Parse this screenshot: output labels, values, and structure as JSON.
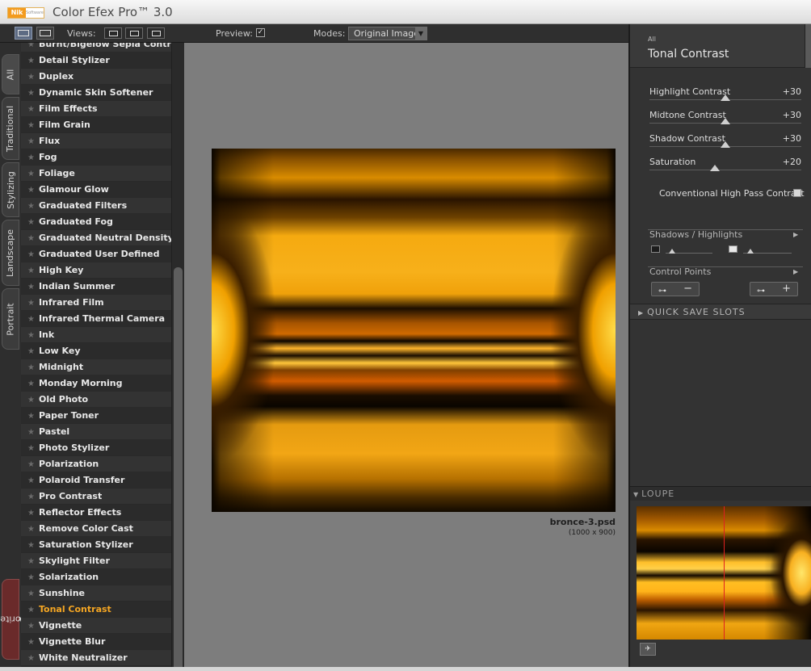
{
  "app": {
    "title": "Color Efex Pro™ 3.0",
    "logo_brand": "Nik",
    "logo_sub": "Software"
  },
  "toolbar": {
    "views_label": "Views:",
    "preview_label": "Preview:",
    "preview_checked": true,
    "modes_label": "Modes:",
    "modes_value": "Original Image"
  },
  "tabs": [
    {
      "label": "All",
      "active": true
    },
    {
      "label": "Traditional"
    },
    {
      "label": "Stylizing"
    },
    {
      "label": "Landscape"
    },
    {
      "label": "Portrait"
    },
    {
      "label": "Favorites"
    }
  ],
  "filters": [
    {
      "name": "Burnt/Bigelow Sepia Contrast"
    },
    {
      "name": "Detail Stylizer"
    },
    {
      "name": "Duplex"
    },
    {
      "name": "Dynamic Skin Softener"
    },
    {
      "name": "Film Effects"
    },
    {
      "name": "Film Grain"
    },
    {
      "name": "Flux"
    },
    {
      "name": "Fog"
    },
    {
      "name": "Foliage"
    },
    {
      "name": "Glamour Glow"
    },
    {
      "name": "Graduated Filters"
    },
    {
      "name": "Graduated Fog"
    },
    {
      "name": "Graduated Neutral Density"
    },
    {
      "name": "Graduated User Defined"
    },
    {
      "name": "High Key"
    },
    {
      "name": "Indian Summer"
    },
    {
      "name": "Infrared Film"
    },
    {
      "name": "Infrared Thermal Camera"
    },
    {
      "name": "Ink"
    },
    {
      "name": "Low Key"
    },
    {
      "name": "Midnight"
    },
    {
      "name": "Monday Morning"
    },
    {
      "name": "Old Photo"
    },
    {
      "name": "Paper Toner"
    },
    {
      "name": "Pastel"
    },
    {
      "name": "Photo Stylizer"
    },
    {
      "name": "Polarization"
    },
    {
      "name": "Polaroid Transfer"
    },
    {
      "name": "Pro Contrast"
    },
    {
      "name": "Reflector Effects"
    },
    {
      "name": "Remove Color Cast"
    },
    {
      "name": "Saturation Stylizer"
    },
    {
      "name": "Skylight Filter"
    },
    {
      "name": "Solarization"
    },
    {
      "name": "Sunshine"
    },
    {
      "name": "Tonal Contrast",
      "active": true
    },
    {
      "name": "Vignette"
    },
    {
      "name": "Vignette Blur"
    },
    {
      "name": "White Neutralizer"
    }
  ],
  "preview": {
    "file_name": "bronce-3.psd",
    "file_dims": "(1000 x 900)"
  },
  "panel": {
    "category": "All",
    "filter_title": "Tonal Contrast",
    "sliders": [
      {
        "label": "Highlight Contrast",
        "value": "+30",
        "fraction": 0.5
      },
      {
        "label": "Midtone Contrast",
        "value": "+30",
        "fraction": 0.5
      },
      {
        "label": "Shadow Contrast",
        "value": "+30",
        "fraction": 0.5
      },
      {
        "label": "Saturation",
        "value": "+20",
        "fraction": 0.43
      }
    ],
    "high_pass_label": "Conventional High Pass Contrast",
    "high_pass_checked": false,
    "shadows_highlights_label": "Shadows / Highlights",
    "control_points_label": "Control Points",
    "control_point_remove": "−",
    "control_point_add": "+",
    "quick_save_label": "QUICK SAVE SLOTS",
    "loupe_label": "LOUPE"
  },
  "colors": {
    "accent": "#f5a623",
    "loupe_marker": "#e02020"
  }
}
